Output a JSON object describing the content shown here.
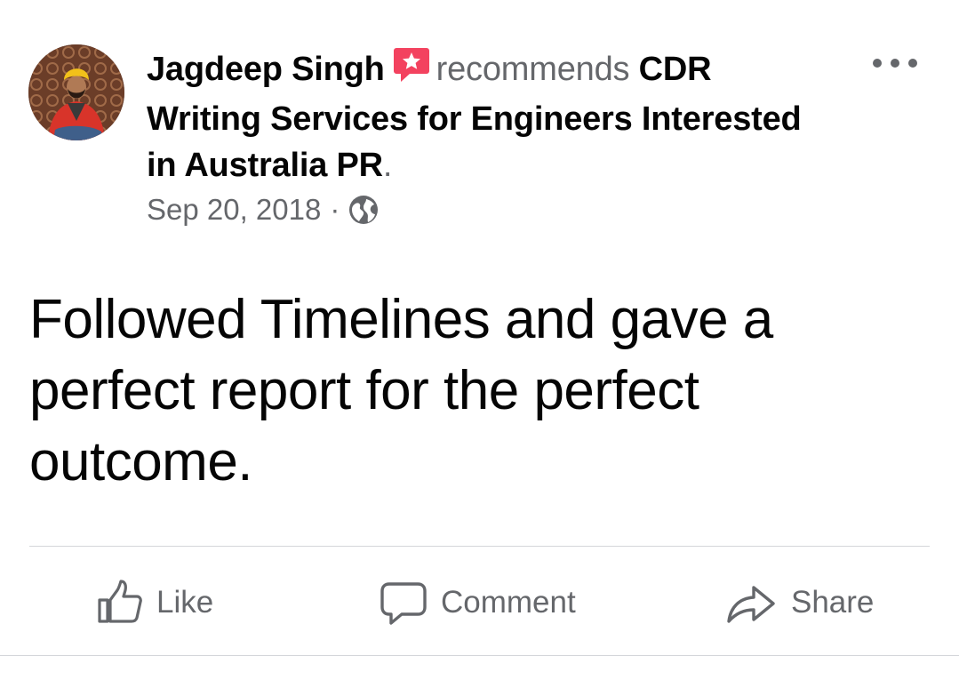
{
  "post": {
    "author": "Jagdeep Singh",
    "action_text": "recommends",
    "page_name": "CDR Writing Services for Engineers Interested in Australia PR",
    "period": ".",
    "date": "Sep 20, 2018",
    "meta_separator": "·",
    "audience_icon": "globe-icon",
    "recommend_icon": "star-speech-bubble-icon",
    "recommend_icon_color": "#f3425f",
    "text": "Followed Timelines and gave a perfect report for the perfect outcome."
  },
  "actions": {
    "like_label": "Like",
    "comment_label": "Comment",
    "share_label": "Share"
  },
  "colors": {
    "primary_text": "#050505",
    "secondary_text": "#65676b",
    "divider": "#d4d6da"
  }
}
